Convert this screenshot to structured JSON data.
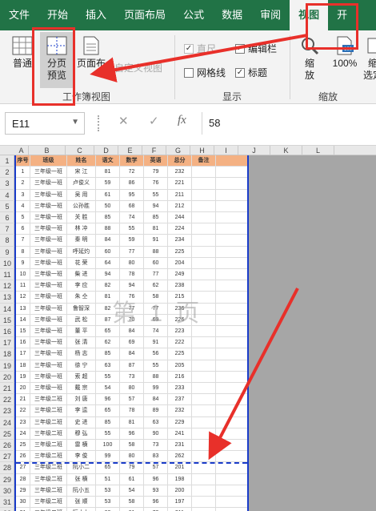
{
  "menu": {
    "tabs": [
      "文件",
      "开始",
      "插入",
      "页面布局",
      "公式",
      "数据",
      "审阅",
      "视图",
      "开"
    ],
    "active_index": 7
  },
  "ribbon": {
    "workbook_views": {
      "normal": "普通",
      "page_break_preview_line1": "分页",
      "page_break_preview_line2": "预览",
      "page_layout": "页面布",
      "custom_views": "自定义视图",
      "group_label": "工作簿视图"
    },
    "show": {
      "ruler": "直尺",
      "formula_bar": "编辑栏",
      "gridlines": "网格线",
      "headings": "标题",
      "group_label": "显示"
    },
    "zoom": {
      "zoom_label_line1": "缩",
      "zoom_label_line2": "放",
      "zoom_100": "100%",
      "zoom_selection_line1": "缩",
      "zoom_selection_line2": "选定",
      "group_label": "缩放"
    }
  },
  "formula_bar": {
    "cell_ref": "E11",
    "fx": "fx",
    "value": "58"
  },
  "sheet": {
    "columns": [
      "A",
      "B",
      "C",
      "D",
      "E",
      "F",
      "G",
      "H",
      "I",
      "J",
      "K",
      "L"
    ],
    "header_row": [
      "序号",
      "班级",
      "姓名",
      "语文",
      "数学",
      "英语",
      "总分",
      "备注"
    ],
    "rows": [
      [
        "1",
        "三年级一班",
        "宋 江",
        "81",
        "72",
        "79",
        "232",
        ""
      ],
      [
        "2",
        "三年级一班",
        "卢俊义",
        "59",
        "86",
        "76",
        "221",
        ""
      ],
      [
        "3",
        "三年级一班",
        "吴 用",
        "61",
        "95",
        "55",
        "211",
        ""
      ],
      [
        "4",
        "三年级一班",
        "公孙胜",
        "50",
        "68",
        "94",
        "212",
        ""
      ],
      [
        "5",
        "三年级一班",
        "关 胜",
        "85",
        "74",
        "85",
        "244",
        ""
      ],
      [
        "6",
        "三年级一班",
        "林 冲",
        "88",
        "55",
        "81",
        "224",
        ""
      ],
      [
        "7",
        "三年级一班",
        "秦 明",
        "84",
        "59",
        "91",
        "234",
        ""
      ],
      [
        "8",
        "三年级一班",
        "呼延灼",
        "60",
        "77",
        "88",
        "225",
        ""
      ],
      [
        "9",
        "三年级一班",
        "花 荣",
        "64",
        "80",
        "60",
        "204",
        ""
      ],
      [
        "10",
        "三年级一班",
        "柴 进",
        "94",
        "78",
        "77",
        "249",
        ""
      ],
      [
        "11",
        "三年级一班",
        "李 应",
        "82",
        "94",
        "62",
        "238",
        ""
      ],
      [
        "12",
        "三年级一班",
        "朱 仝",
        "81",
        "76",
        "58",
        "215",
        ""
      ],
      [
        "13",
        "三年级一班",
        "鲁智深",
        "82",
        "77",
        "77",
        "236",
        ""
      ],
      [
        "14",
        "三年级一班",
        "武 松",
        "87",
        "70",
        "69",
        "226",
        ""
      ],
      [
        "15",
        "三年级一班",
        "董 平",
        "65",
        "84",
        "74",
        "223",
        ""
      ],
      [
        "16",
        "三年级一班",
        "张 清",
        "62",
        "69",
        "91",
        "222",
        ""
      ],
      [
        "17",
        "三年级一班",
        "杨 志",
        "85",
        "84",
        "56",
        "225",
        ""
      ],
      [
        "18",
        "三年级一班",
        "徐 宁",
        "63",
        "87",
        "55",
        "205",
        ""
      ],
      [
        "19",
        "三年级一班",
        "索 超",
        "55",
        "73",
        "88",
        "216",
        ""
      ],
      [
        "20",
        "三年级一班",
        "戴 宗",
        "54",
        "80",
        "99",
        "233",
        ""
      ],
      [
        "21",
        "三年级二班",
        "刘 唐",
        "96",
        "57",
        "84",
        "237",
        ""
      ],
      [
        "22",
        "三年级二班",
        "李 逵",
        "65",
        "78",
        "89",
        "232",
        ""
      ],
      [
        "23",
        "三年级二班",
        "史 进",
        "85",
        "81",
        "63",
        "229",
        ""
      ],
      [
        "24",
        "三年级二班",
        "穆 弘",
        "55",
        "96",
        "90",
        "241",
        ""
      ],
      [
        "25",
        "三年级二班",
        "雷 横",
        "100",
        "58",
        "73",
        "231",
        ""
      ],
      [
        "26",
        "三年级二班",
        "李 俊",
        "99",
        "80",
        "83",
        "262",
        ""
      ],
      [
        "27",
        "三年级二班",
        "阮小二",
        "65",
        "79",
        "57",
        "201",
        ""
      ],
      [
        "28",
        "三年级二班",
        "张 横",
        "51",
        "61",
        "96",
        "198",
        ""
      ],
      [
        "29",
        "三年级二班",
        "阮小五",
        "53",
        "54",
        "93",
        "200",
        ""
      ],
      [
        "30",
        "三年级二班",
        "张 顺",
        "53",
        "58",
        "96",
        "197",
        ""
      ],
      [
        "31",
        "三年级二班",
        "阮小七",
        "80",
        "61",
        "70",
        "211",
        ""
      ]
    ],
    "row_headers": [
      "1",
      "2",
      "3",
      "4",
      "5",
      "6",
      "7",
      "8",
      "9",
      "10",
      "11",
      "12",
      "13",
      "14",
      "15",
      "16",
      "17",
      "18",
      "19",
      "20",
      "21",
      "22",
      "23",
      "24",
      "25",
      "26",
      "27",
      "28",
      "29",
      "30",
      "31",
      "32"
    ],
    "watermark": "第 1 页"
  },
  "colors": {
    "accent": "#217346",
    "annotation_red": "#e8302a",
    "page_border_blue": "#1a3cc9",
    "header_fill": "#f4b183"
  }
}
